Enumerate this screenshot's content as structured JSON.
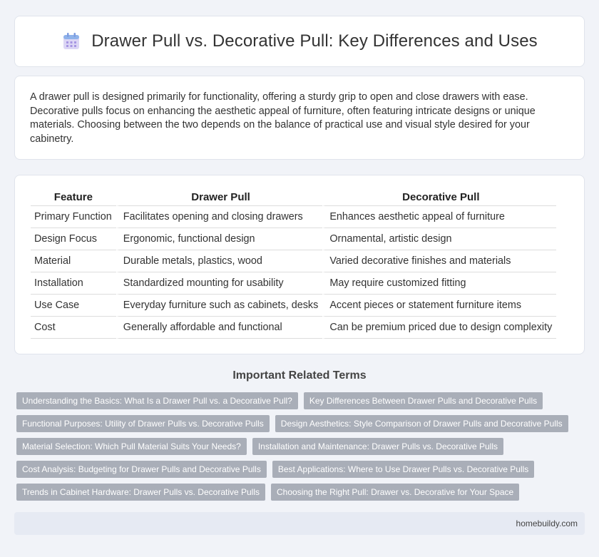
{
  "header": {
    "title": "Drawer Pull vs. Decorative Pull: Key Differences and Uses",
    "icon": "calendar-icon"
  },
  "intro": {
    "text": "A drawer pull is designed primarily for functionality, offering a sturdy grip to open and close drawers with ease. Decorative pulls focus on enhancing the aesthetic appeal of furniture, often featuring intricate designs or unique materials. Choosing between the two depends on the balance of practical use and visual style desired for your cabinetry."
  },
  "table": {
    "headers": [
      "Feature",
      "Drawer Pull",
      "Decorative Pull"
    ],
    "rows": [
      [
        "Primary Function",
        "Facilitates opening and closing drawers",
        "Enhances aesthetic appeal of furniture"
      ],
      [
        "Design Focus",
        "Ergonomic, functional design",
        "Ornamental, artistic design"
      ],
      [
        "Material",
        "Durable metals, plastics, wood",
        "Varied decorative finishes and materials"
      ],
      [
        "Installation",
        "Standardized mounting for usability",
        "May require customized fitting"
      ],
      [
        "Use Case",
        "Everyday furniture such as cabinets, desks",
        "Accent pieces or statement furniture items"
      ],
      [
        "Cost",
        "Generally affordable and functional",
        "Can be premium priced due to design complexity"
      ]
    ]
  },
  "related": {
    "title": "Important Related Terms",
    "tags": [
      [
        "Understanding the Basics: What Is a Drawer Pull vs. a Decorative Pull?",
        "Key Differences Between Drawer Pulls and Decorative Pulls"
      ],
      [
        "Functional Purposes: Utility of Drawer Pulls vs. Decorative Pulls",
        "Design Aesthetics: Style Comparison of Drawer Pulls and Decorative Pulls"
      ],
      [
        "Material Selection: Which Pull Material Suits Your Needs?",
        "Installation and Maintenance: Drawer Pulls vs. Decorative Pulls"
      ],
      [
        "Cost Analysis: Budgeting for Drawer Pulls and Decorative Pulls",
        "Best Applications: Where to Use Drawer Pulls vs. Decorative Pulls"
      ],
      [
        "Trends in Cabinet Hardware: Drawer Pulls vs. Decorative Pulls",
        "Choosing the Right Pull: Drawer vs. Decorative for Your Space"
      ]
    ]
  },
  "footer": {
    "site": "homebuildy.com"
  },
  "colors": {
    "background": "#f1f3f8",
    "tag": "#a9aeb8",
    "footer": "#e6eaf3"
  }
}
